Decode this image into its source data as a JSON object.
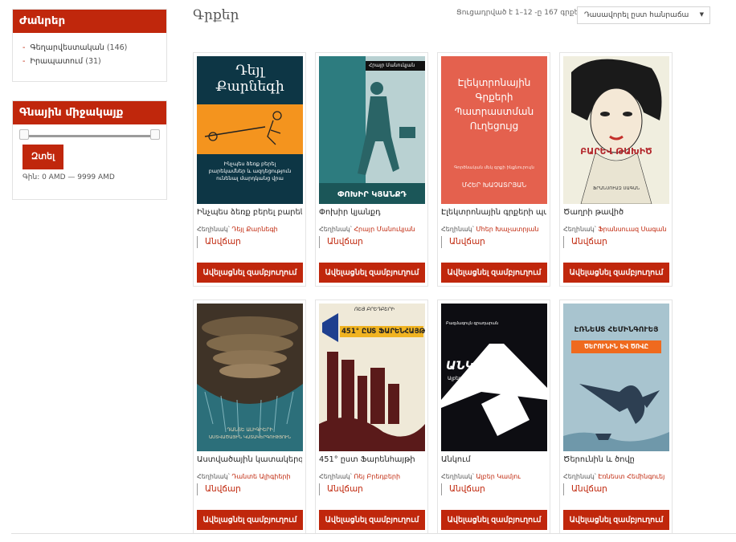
{
  "sidebar": {
    "categories": {
      "title": "Ժանրեր",
      "items": [
        {
          "label": "Գեղարվեստական",
          "count": "(146)"
        },
        {
          "label": "Իրապատում",
          "count": "(31)"
        }
      ]
    },
    "price_filter": {
      "title": "Գնային միջակայք",
      "button": "Զտել",
      "price_text": "Գին: 0 AMD — 9999 AMD"
    }
  },
  "header": {
    "title": "Գրքեր",
    "result_count": "Ցուցադրված է 1–12 -ը 167 գրքերից",
    "sort": "Դասավորել ըստ հանրաճա"
  },
  "products": [
    {
      "title": "Ինչպես ձեռք բերել բարեկա",
      "author_prefix": "Հեղինակ՝",
      "author": "Դեյլ Քարնեգի",
      "price": "Անվճար",
      "button": "Ավելացնել զամբյուղում",
      "cover": {
        "bg": "#0d3645",
        "title_line1": "Դեյլ",
        "title_line2": "Քարնեգի",
        "subtitle": "Ինչպես ձեռք բերել բարեկամներ և ազդեցություն ունենալ մարդկանց վրա"
      }
    },
    {
      "title": "Փոխիր կյանքդ",
      "author_prefix": "Հեղինակ՝",
      "author": "Հրայր Մանուկյան",
      "price": "Անվճար",
      "button": "Ավելացնել զամբյուղում",
      "cover": {
        "bg": "#b9d1d2",
        "top": "Հրայր Մանուկյան",
        "bottom": "ՓՈԽԻՐ ԿՅԱՆՔԴ"
      }
    },
    {
      "title": "Էլեկտրոնային գրքերի պա",
      "author_prefix": "Հեղինակ՝",
      "author": "Մհեր Խաչատրյան",
      "price": "Անվճար",
      "button": "Ավելացնել զամբյուղում",
      "cover": {
        "bg": "#e4614e",
        "lines": [
          "Էլեկտրոնային",
          "Գրքերի",
          "Պատրաստման",
          "Ուղեցույց"
        ],
        "small": "Գործնական մեկ գրքի ինքնուրույն",
        "author": "ՄՀԵՐ ԽԱՉԱՏՐՅԱՆ"
      }
    },
    {
      "title": "Ծաղրի թավիծ",
      "author_prefix": "Հեղինակ՝",
      "author": "Ֆրանսուազ Սագան",
      "price": "Անվճար",
      "button": "Ավելացնել զամբյուղում",
      "cover": {
        "bg": "#f0eedf",
        "title": "ԲԱՐԵՎ ԹԱԽԻԾ",
        "author": "ՖՐԱՆՍՈՒԱԶ ՍԱԳԱՆ"
      }
    },
    {
      "title": "Աստվածային կատակերգու",
      "author_prefix": "Հեղինակ՝",
      "author": "Դանտե Ալիգիերի",
      "price": "Անվճար",
      "button": "Ավելացնել զամբյուղում",
      "cover": {
        "bg": "#4a3b2c",
        "author": "ԴԱՆՏԵ ԱԼԻԳԻԵՐԻ",
        "title": "ԱՍՏՎԱԾԱՅԻՆ ԿԱՏԱԿԵՐԳՈՒԹՅՈՒՆ"
      }
    },
    {
      "title": "451° ըստ Ֆարենհայթի",
      "author_prefix": "Հեղինակ՝",
      "author": "Ռեյ Բրեդբերի",
      "price": "Անվճար",
      "button": "Ավելացնել զամբյուղում",
      "cover": {
        "bg": "#efe9d8",
        "top": "ՌԵՅ ԲՐԵԴԲԵՐԻ",
        "title": "451° ԸՍՏ ՖԱՐԵՆՀԱՅԹԻ"
      }
    },
    {
      "title": "Անկում",
      "author_prefix": "Հեղինակ՝",
      "author": "Ալբեր Կամյու",
      "price": "Անվճար",
      "button": "Ավելացնել զամբյուղում",
      "cover": {
        "bg": "#ffffff",
        "top": "Բազմագույն գրադարան",
        "title": "ԱՆԿՈՒՄ",
        "author": "Ալբեր Կամյու"
      }
    },
    {
      "title": "Ծերունին և ծովը",
      "author_prefix": "Հեղինակ՝",
      "author": "Էռնեստ Հեմինգուեյ",
      "price": "Անվճար",
      "button": "Ավելացնել զամբյուղում",
      "cover": {
        "bg": "#a8c4cf",
        "author": "ԷՌՆԵՍՏ ՀԵՄԻՆԳՈՒԵՅ",
        "title": "ԾԵՐՈՒՆԻՆ ԵՎ ԾՈՎԸ"
      }
    }
  ]
}
